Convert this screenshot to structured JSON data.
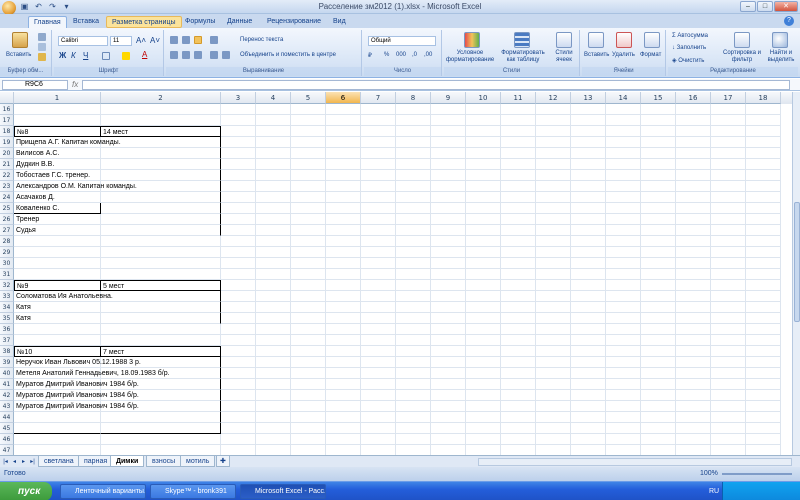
{
  "window": {
    "title": "Расселение зм2012 (1).xlsx - Microsoft Excel"
  },
  "ribbon_tabs": [
    "Главная",
    "Вставка",
    "Разметка страницы",
    "Формулы",
    "Данные",
    "Рецензирование",
    "Вид"
  ],
  "ribbon": {
    "paste_label": "Вставить",
    "clipboard_label": "Буфер обм...",
    "font_name": "Calibri",
    "font_size": "11",
    "font_label": "Шрифт",
    "wrap_text": "Перенос текста",
    "merge_center": "Объединить и поместить в центре",
    "alignment_label": "Выравнивание",
    "number_format": "Общий",
    "number_label": "Число",
    "cond_format": "Условное форматирование",
    "format_table": "Форматировать как таблицу",
    "cell_styles": "Стили ячеек",
    "styles_label": "Стили",
    "insert": "Вставить",
    "delete": "Удалить",
    "format": "Формат",
    "cells_label": "Ячейки",
    "autosum": "Автосумма",
    "fill": "Заполнить",
    "clear": "Очистить",
    "sort_filter": "Сортировка и фильтр",
    "find_select": "Найти и выделить",
    "editing_label": "Редактирование"
  },
  "namebox": "R9C6",
  "fx": "fx",
  "columns": [
    "1",
    "2",
    "3",
    "4",
    "5",
    "6",
    "7",
    "8",
    "9",
    "10",
    "11",
    "12",
    "13",
    "14",
    "15",
    "16",
    "17",
    "18"
  ],
  "rows": [
    {
      "n": "16",
      "a": "",
      "b": ""
    },
    {
      "n": "17",
      "a": "",
      "b": ""
    },
    {
      "n": "18",
      "a": "№8",
      "b": "14 мест"
    },
    {
      "n": "19",
      "a": "Прищепа А.Г. Капитан команды.",
      "b": ""
    },
    {
      "n": "20",
      "a": "Вилисов А.С.",
      "b": ""
    },
    {
      "n": "21",
      "a": "Дудкин В.В.",
      "b": ""
    },
    {
      "n": "22",
      "a": "Тобостаев Г.С. тренер.",
      "b": ""
    },
    {
      "n": "23",
      "a": "Александров О.М. Капитан команды.",
      "b": ""
    },
    {
      "n": "24",
      "a": "Асачаков Д.",
      "b": ""
    },
    {
      "n": "25",
      "a": "Коваленко С.",
      "b": ""
    },
    {
      "n": "26",
      "a": "Тренер",
      "b": ""
    },
    {
      "n": "27",
      "a": "Судья",
      "b": ""
    },
    {
      "n": "28",
      "a": "",
      "b": ""
    },
    {
      "n": "29",
      "a": "",
      "b": ""
    },
    {
      "n": "30",
      "a": "",
      "b": ""
    },
    {
      "n": "31",
      "a": "",
      "b": ""
    },
    {
      "n": "32",
      "a": "№9",
      "b": "5 мест"
    },
    {
      "n": "33",
      "a": "Соломатова Ия Анатольевна.",
      "b": ""
    },
    {
      "n": "34",
      "a": "Катя",
      "b": ""
    },
    {
      "n": "35",
      "a": "Катя",
      "b": ""
    },
    {
      "n": "36",
      "a": "",
      "b": ""
    },
    {
      "n": "37",
      "a": "",
      "b": ""
    },
    {
      "n": "38",
      "a": "№10",
      "b": "7 мест"
    },
    {
      "n": "39",
      "a": "Неручок Иван Львович 05.12.1988 3 р.",
      "b": ""
    },
    {
      "n": "40",
      "a": "Метеля Анатолий Геннадьевич, 18.09.1983 б/р.",
      "b": ""
    },
    {
      "n": "41",
      "a": "Муратов Дмитрий Иванович 1984 б/р.",
      "b": ""
    },
    {
      "n": "42",
      "a": "Муратов Дмитрий Иванович 1984 б/р.",
      "b": ""
    },
    {
      "n": "43",
      "a": "Муратов Дмитрий Иванович 1984 б/р.",
      "b": ""
    },
    {
      "n": "44",
      "a": "",
      "b": ""
    },
    {
      "n": "45",
      "a": "",
      "b": ""
    },
    {
      "n": "46",
      "a": "",
      "b": ""
    },
    {
      "n": "47",
      "a": "",
      "b": ""
    }
  ],
  "sheets": [
    "светлана",
    "парная",
    "Димки",
    "взносы",
    "мотиль"
  ],
  "active_sheet": "Димки",
  "status": {
    "ready": "Готово",
    "zoom": "100%"
  },
  "taskbar": {
    "start": "пуск",
    "buttons": [
      "Ленточный варианты...",
      "Skype™ - bronk391",
      "Microsoft Excel - Расс..."
    ],
    "lang": "RU"
  }
}
